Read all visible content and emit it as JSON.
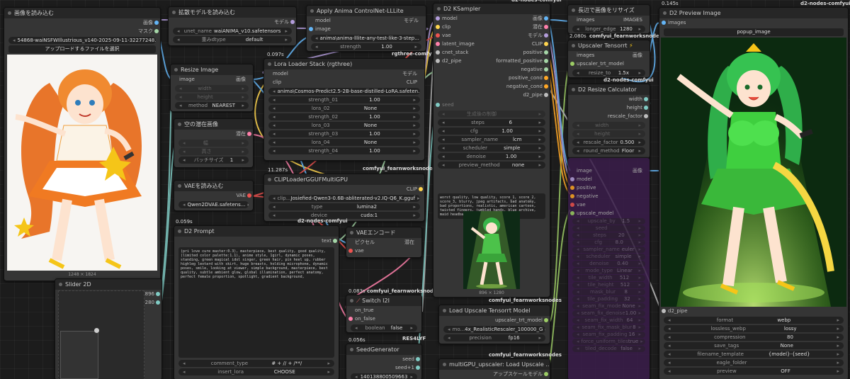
{
  "nodes": {
    "load_image": {
      "title": "画像を読み込む",
      "out_image": "画像",
      "out_mask": "マスク",
      "file": "54868-waiNSFWIllustrious_v140-2025-09-11-32277248...",
      "upload_btn": "アップロードするファイルを選択",
      "dims": "1248 × 1824"
    },
    "load_diffusion": {
      "title": "拡散モデルを読み込む",
      "out_model": "モデル",
      "w1_label": "unet_name",
      "w1_value": "waiANIMA_v10.safetensors",
      "w2_label": "重みdtype",
      "w2_value": "default"
    },
    "controlnet": {
      "title": "Apply Anima ControlNet-LLLite",
      "in_model": "model",
      "in_image": "image",
      "out_model": "モデル",
      "w1_value": "anima\\anima-lllite-any-test-like-3-step...",
      "w2_label": "strength",
      "w2_value": "1.00",
      "group": "rgthree-comfy",
      "time": "0.097s"
    },
    "lora_stack": {
      "title": "Lora Loader Stack (rgthree)",
      "in_model": "model",
      "in_clip": "clip",
      "out_model": "モデル",
      "out_clip": "CLIP",
      "widgets": [
        {
          "label": "",
          "value": "anima\\Cosmos-Predict2.5-2B-base-distilled-LoRA.safeten..."
        },
        {
          "label": "strength_01",
          "value": "1.00"
        },
        {
          "label": "lora_02",
          "value": "None"
        },
        {
          "label": "strength_02",
          "value": "1.00"
        },
        {
          "label": "lora_03",
          "value": "None"
        },
        {
          "label": "strength_03",
          "value": "1.00"
        },
        {
          "label": "lora_04",
          "value": "None"
        },
        {
          "label": "strength_04",
          "value": "1.00"
        }
      ],
      "group": "comfyui_fearnworksnodes",
      "time": "11.287s"
    },
    "resize_image": {
      "title": "Resize Image",
      "in_image": "image",
      "out_image": "画像",
      "w1": "width",
      "w2": "height",
      "w3_label": "method",
      "w3_value": "NEAREST"
    },
    "empty_latent": {
      "title": "空の潜在画像",
      "out_latent": "潜在",
      "w1": "幅",
      "w2": "高さ",
      "w3_label": "バッチサイズ",
      "w3_value": "1"
    },
    "vae_load": {
      "title": "VAEを読み込む",
      "out_vae": "VAE",
      "w1_value": "Qwen2DVAE.safetens..."
    },
    "clip_loader": {
      "title": "CLIPLoaderGGUFMultiGPU",
      "out_clip": "CLIP",
      "w1_label": "clip...",
      "w1_value": "Josiefied-Qwen3-0.6B-abliterated-v2.IQ-Q6_K.gguf",
      "w2_label": "type",
      "w2_value": "lumina2",
      "w3_label": "device",
      "w3_value": "cuda:1",
      "group": "d2-nodes-comfyui"
    },
    "d2_prompt": {
      "title": "D2 Prompt",
      "out_text": "text",
      "time": "0.059s",
      "prompt": "(pri love cure master:0.3), masterpiece, best quality, good quality, (limited color palette:1.1), anime style, 1girl, dynamic poses, standing, green magical idol singer, green hair, pin heel up, rubber highleg leotard with skirt, huge breasts, holding microphone, dynamic poses, smile, looking at viewer, simple background, masterpiece, best quality, subtle ambient glow, global illumination, perfect anatomy, perfect female proportion, spotlight, gradient background,",
      "w1_label": "comment_type",
      "w1_value": "# + // + /**/",
      "w2_label": "insert_lora",
      "w2_value": "CHOOSE"
    },
    "vae_encode": {
      "title": "VAEエンコード",
      "in_pixels": "ピクセル",
      "in_vae": "vae",
      "out_latent": "潜在"
    },
    "slider2d": {
      "title": "Slider 2D",
      "out_x": "896",
      "out_y": "1280"
    },
    "switch_i2i": {
      "title": "Switch I2I",
      "in_true": "on_true",
      "in_false": "on_false",
      "w1_label": "boolean",
      "w1_value": "false",
      "group": "RES4LYF",
      "time": "0.083s",
      "group2": "comfyui_fearnworksnodes"
    },
    "seed_gen": {
      "title": "SeedGenerator",
      "out_seed": "seed",
      "out_seed1": "seed+1",
      "w1_value": "140138800509663",
      "time": "0.056s"
    },
    "ksampler": {
      "title": "D2 KSampler",
      "in": [
        "model",
        "clip",
        "vae",
        "latent_image",
        "cnet_stack",
        "d2_pipe"
      ],
      "out": [
        "画像",
        "潜在",
        "モデル",
        "CLIP",
        "positive",
        "formatted_positive",
        "negative",
        "positive_cond",
        "negative_cond",
        "d2_pipe"
      ],
      "seed_label": "seed",
      "seed_ctrl": "生成後の制御",
      "widgets": [
        {
          "label": "steps",
          "value": "6"
        },
        {
          "label": "cfg",
          "value": "1.00"
        },
        {
          "label": "sampler_name",
          "value": "lcm"
        },
        {
          "label": "scheduler",
          "value": "simple"
        },
        {
          "label": "denoise",
          "value": "1.00"
        },
        {
          "label": "preview_method",
          "value": "none"
        }
      ],
      "negative": "worst quality, low quality, score_1, score_2, score_3, blurry, jpeg artifacts, bad anatomy, bad proportions, realistic, american cartoon, twisted fingers, jumbled hands, blue archive, maid headband, man,",
      "dims": "896 × 1280",
      "group": "comfyui_fearnworksnodes",
      "group_top": "d2-nodes-comfyui"
    },
    "load_upscale": {
      "title": "Load Upscale Tensorrt Model",
      "out": "upscaler_trt_model",
      "w1_label": "mo...",
      "w1_value": "4x_RealisticRescaler_100000_G",
      "w2_label": "precision",
      "w2_value": "fp16",
      "group": "comfyui_fearnworksnodes"
    },
    "multigpu_up": {
      "title": "multiGPU_upscaler: Load Upscale ...",
      "out": "アップスケールモデル"
    },
    "resize_long": {
      "title": "長辺で画像をリサイズ",
      "in_images": "images",
      "out_images": "IMAGES",
      "w1_label": "longer_edge",
      "w1_value": "1280",
      "time": "2.080s",
      "group": "comfyui_fearnworksnodes"
    },
    "upscaler_trt": {
      "title": "Upscaler Tensorrt",
      "title_icon": "⚡",
      "in_images": "images",
      "in_trt": "upscaler_trt_model",
      "out": "画像",
      "w1_label": "resize_to",
      "w1_value": "1.5x",
      "group": "d2-nodes-comfyui"
    },
    "resize_calc": {
      "title": "D2 Resize Calculator",
      "out": [
        "width",
        "height",
        "rescale_factor"
      ],
      "w_width": "width",
      "w_height": "height",
      "w1_label": "rescale_factor",
      "w1_value": "0.500",
      "w2_label": "round_method",
      "w2_value": "Floor"
    },
    "purple_node": {
      "in": [
        "image",
        "model",
        "positive",
        "negative",
        "vae",
        "upscale_model"
      ],
      "out": "画像",
      "widgets": [
        {
          "label": "upscale_by",
          "value": "1.5"
        },
        {
          "label": "seed",
          "value": ""
        },
        {
          "label": "steps",
          "value": "20"
        },
        {
          "label": "cfg",
          "value": "8.0"
        },
        {
          "label": "sampler_name",
          "value": "euler"
        },
        {
          "label": "scheduler",
          "value": "simple"
        },
        {
          "label": "denoise",
          "value": "0.40"
        },
        {
          "label": "mode_type",
          "value": "Linear"
        },
        {
          "label": "tile_width",
          "value": "512"
        },
        {
          "label": "tile_height",
          "value": "512"
        },
        {
          "label": "mask_blur",
          "value": "8"
        },
        {
          "label": "tile_padding",
          "value": "32"
        },
        {
          "label": "seam_fix_mode",
          "value": "None"
        },
        {
          "label": "seam_fix_denoise",
          "value": "1.00"
        },
        {
          "label": "seam_fix_width",
          "value": "64"
        },
        {
          "label": "seam_fix_mask_blur",
          "value": "8"
        },
        {
          "label": "seam_fix_padding",
          "value": "16"
        },
        {
          "label": "force_uniform_tiles",
          "value": "true"
        },
        {
          "label": "tiled_decode",
          "value": "false"
        }
      ]
    },
    "preview": {
      "title": "D2 Preview Image",
      "in_images": "images",
      "popup_btn": "popup_image",
      "in_pipe": "d2_pipe",
      "time": "0.145s",
      "group": "d2-nodes-comfyui",
      "widgets": [
        {
          "label": "format",
          "value": "webp"
        },
        {
          "label": "lossless_webp",
          "value": "lossy"
        },
        {
          "label": "compression",
          "value": "80"
        },
        {
          "label": "save_tags",
          "value": "None"
        },
        {
          "label": "filename_template",
          "value": "{model}-{seed}"
        },
        {
          "label": "eagle_folder",
          "value": ""
        },
        {
          "label": "preview",
          "value": "OFF"
        }
      ]
    }
  },
  "colors": {
    "model": "#b39ddb",
    "clip": "#ffd54f",
    "vae": "#ef5350",
    "image": "#64b5f6",
    "latent": "#ff80ab",
    "cond": "#ffa726"
  }
}
